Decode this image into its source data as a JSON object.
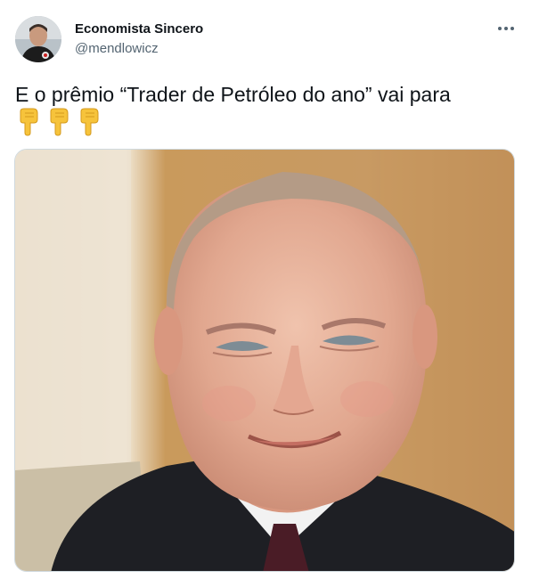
{
  "tweet": {
    "author_name": "Economista Sincero",
    "author_handle": "@mendlowicz",
    "text": "E o prêmio “Trader de Petróleo do ano” vai para",
    "emojis": [
      "pointing-down-emoji",
      "pointing-down-emoji",
      "pointing-down-emoji"
    ],
    "more_icon": "more-horizontal-icon",
    "media_description_icon": "photo"
  },
  "colors": {
    "text_primary": "#0f1419",
    "text_secondary": "#536471",
    "border": "#cfd9de",
    "emoji_yellow": "#f6c33b"
  }
}
